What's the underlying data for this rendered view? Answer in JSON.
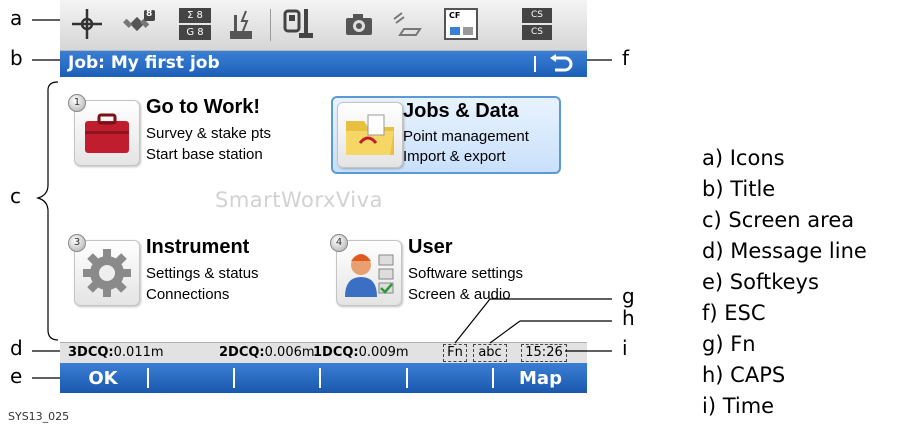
{
  "title_bar": {
    "title": "Job: My first job",
    "esc_icon": "back-arrow-icon"
  },
  "icon_bar": {
    "icons": [
      "position-crosshair-icon",
      "satellite-count-icon",
      "satellite-sigma-gps-icon",
      "radio-link-icon",
      "instrument-status-icon",
      "camera-icon",
      "photogrammetry-icon",
      "cf-card-icon",
      "cs-controller-icon"
    ],
    "satellite_count": "8",
    "sigma_top": "Σ 8",
    "sigma_bottom": "G 8",
    "card_label": "CF",
    "cs_top": "CS",
    "cs_bottom": "CS"
  },
  "tiles": [
    {
      "number": "1",
      "title": "Go to Work!",
      "line1": "Survey & stake pts",
      "line2": "Start base station",
      "icon": "toolbox-icon",
      "selected": false
    },
    {
      "number": "2",
      "title": "Jobs & Data",
      "line1": "Point management",
      "line2": "Import & export",
      "icon": "folder-icon",
      "selected": true
    },
    {
      "number": "3",
      "title": "Instrument",
      "line1": "Settings & status",
      "line2": "Connections",
      "icon": "gear-icon",
      "selected": false
    },
    {
      "number": "4",
      "title": "User",
      "line1": "Software settings",
      "line2": "Screen & audio",
      "icon": "user-settings-icon",
      "selected": false
    }
  ],
  "watermark": "SmartWorxViva",
  "message_line": {
    "q3_label": "3DCQ:",
    "q3_value": "0.011m",
    "q2_label": "2DCQ:",
    "q2_value": "0.006m",
    "q1_label": "1DCQ:",
    "q1_value": "0.009m",
    "fn": "Fn",
    "caps": "abc",
    "time": "15:26"
  },
  "softkeys": [
    "OK",
    "",
    "",
    "",
    "",
    "Map"
  ],
  "callout_letters": {
    "a": "a",
    "b": "b",
    "c": "c",
    "d": "d",
    "e": "e",
    "f": "f",
    "g": "g",
    "h": "h",
    "i": "i"
  },
  "legend": [
    "a) Icons",
    "b) Title",
    "c) Screen area",
    "d) Message line",
    "e) Softkeys",
    "f) ESC",
    "g) Fn",
    "h) CAPS",
    "i) Time"
  ],
  "figure_id": "SYS13_025",
  "colors": {
    "title_bar": "#1d5fb8",
    "softkey_bar": "#1a58ad",
    "selection": "#5a9ad6",
    "message_bg": "#e2e2e2"
  }
}
